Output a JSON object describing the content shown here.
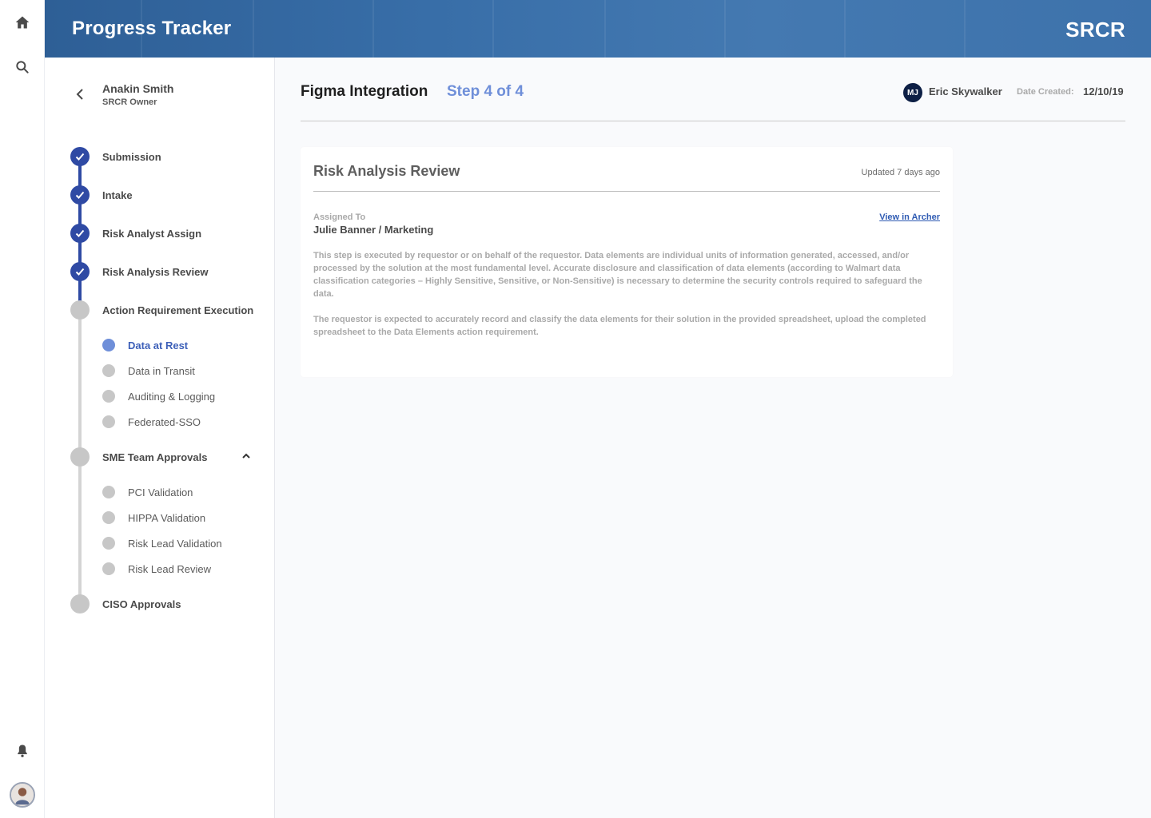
{
  "header": {
    "title": "Progress Tracker",
    "brand": "SRCR"
  },
  "rail": {
    "icons": [
      "home-icon",
      "search-icon",
      "bell-icon",
      "avatar"
    ]
  },
  "owner": {
    "name": "Anakin Smith",
    "role": "SRCR Owner"
  },
  "steps": [
    {
      "label": "Submission",
      "status": "done"
    },
    {
      "label": "Intake",
      "status": "done"
    },
    {
      "label": "Risk Analyst Assign",
      "status": "done"
    },
    {
      "label": "Risk Analysis Review",
      "status": "done"
    },
    {
      "label": "Action Requirement Execution",
      "status": "pending",
      "substeps": [
        {
          "label": "Data at Rest",
          "status": "active"
        },
        {
          "label": "Data in Transit",
          "status": "pending"
        },
        {
          "label": "Auditing & Logging",
          "status": "pending"
        },
        {
          "label": "Federated-SSO",
          "status": "pending"
        }
      ]
    },
    {
      "label": "SME Team Approvals",
      "status": "pending",
      "expanded": true,
      "substeps": [
        {
          "label": "PCI Validation",
          "status": "pending"
        },
        {
          "label": "HIPPA Validation",
          "status": "pending"
        },
        {
          "label": "Risk Lead Validation",
          "status": "pending"
        },
        {
          "label": "Risk Lead Review",
          "status": "pending"
        }
      ]
    },
    {
      "label": "CISO Approvals",
      "status": "pending"
    }
  ],
  "main": {
    "title": "Figma Integration",
    "step": "Step 4 of 4",
    "user_initials": "MJ",
    "user_name": "Eric Skywalker",
    "date_label": "Date Created:",
    "date_value": "12/10/19"
  },
  "card": {
    "title": "Risk Analysis Review",
    "updated": "Updated 7 days ago",
    "assigned_label": "Assigned To",
    "assigned_value": "Julie Banner / Marketing",
    "link": "View in Archer",
    "paragraph1": "This step is executed by requestor or on behalf of the requestor. Data elements are individual units of information generated, accessed, and/or processed by the solution at the most fundamental level. Accurate disclosure and classification of data elements (according to Walmart data classification categories – Highly Sensitive, Sensitive, or Non-Sensitive) is necessary to determine the security controls required to safeguard the data.",
    "paragraph2": "The requestor is expected to accurately record and classify the data elements for their solution in the provided spreadsheet, upload the completed spreadsheet to the Data Elements action requirement."
  },
  "colors": {
    "header": "#386ea8",
    "step_done": "#2f4aa4",
    "step_pending": "#c7c7c7",
    "active_substep": "#6f8fd9",
    "link": "#2f5bb3"
  }
}
